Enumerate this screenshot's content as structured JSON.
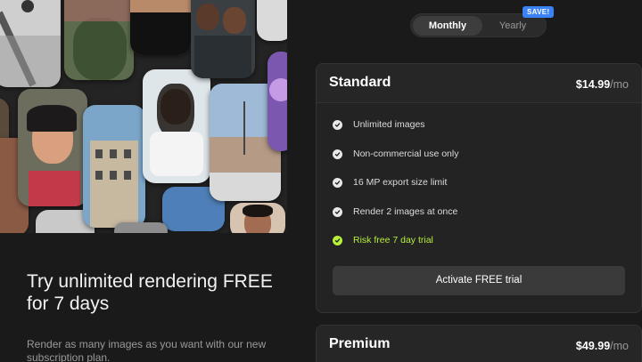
{
  "billing_toggle": {
    "options": [
      "Monthly",
      "Yearly"
    ],
    "selected": "Monthly",
    "badge": "SAVE!"
  },
  "promo": {
    "title": "Try unlimited rendering FREE for 7 days",
    "subtitle": "Render as many images as you want with our new subscription plan."
  },
  "plans": [
    {
      "name": "Standard",
      "price": "$14.99",
      "period": "/mo",
      "features": [
        {
          "text": "Unlimited images",
          "highlight": false
        },
        {
          "text": "Non-commercial use only",
          "highlight": false
        },
        {
          "text": "16 MP export size limit",
          "highlight": false
        },
        {
          "text": "Render 2 images at once",
          "highlight": false
        },
        {
          "text": "Risk free 7 day trial",
          "highlight": true
        }
      ],
      "cta": "Activate FREE trial"
    },
    {
      "name": "Premium",
      "price": "$49.99",
      "period": "/mo"
    }
  ],
  "colors": {
    "background": "#1a1a1a",
    "card": "#232323",
    "highlight": "#b6f03c",
    "badge": "#3b82f6"
  }
}
